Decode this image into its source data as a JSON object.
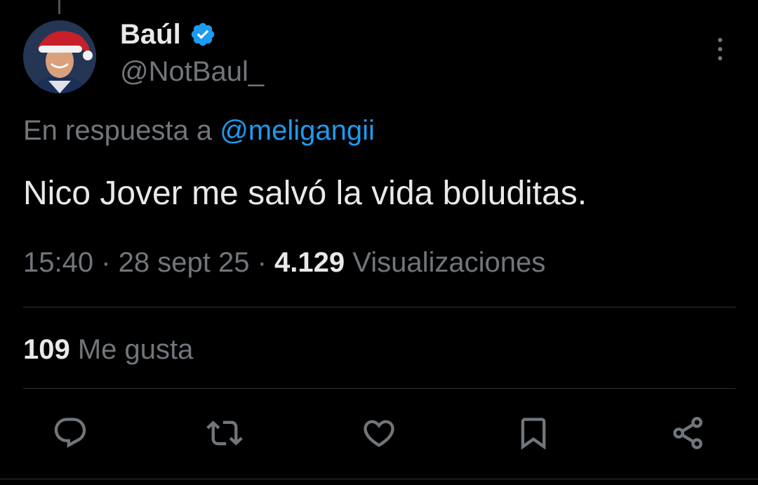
{
  "author": {
    "display_name": "Baúl",
    "handle": "@NotBaul_",
    "verified": true,
    "avatar_icon": "avatar-santa-hat"
  },
  "reply_to": {
    "prefix": "En respuesta a ",
    "mention": "@meligangii"
  },
  "tweet": {
    "text": "Nico Jover me salvó la vida boluditas."
  },
  "meta": {
    "time": "15:40",
    "separator": " · ",
    "date": "28 sept 25",
    "views_count": "4.129",
    "views_label": " Visualizaciones"
  },
  "stats": {
    "likes_count": "109",
    "likes_label": " Me gusta"
  },
  "actions": [
    {
      "name": "reply",
      "icon": "speech-bubble-icon"
    },
    {
      "name": "retweet",
      "icon": "retweet-icon"
    },
    {
      "name": "like",
      "icon": "heart-icon"
    },
    {
      "name": "bookmark",
      "icon": "bookmark-icon"
    },
    {
      "name": "share",
      "icon": "share-icon"
    }
  ],
  "colors": {
    "background": "#000000",
    "primary_text": "#e7e9ea",
    "secondary_text": "#71767b",
    "accent": "#1d9bf0",
    "divider": "#2f3336"
  }
}
